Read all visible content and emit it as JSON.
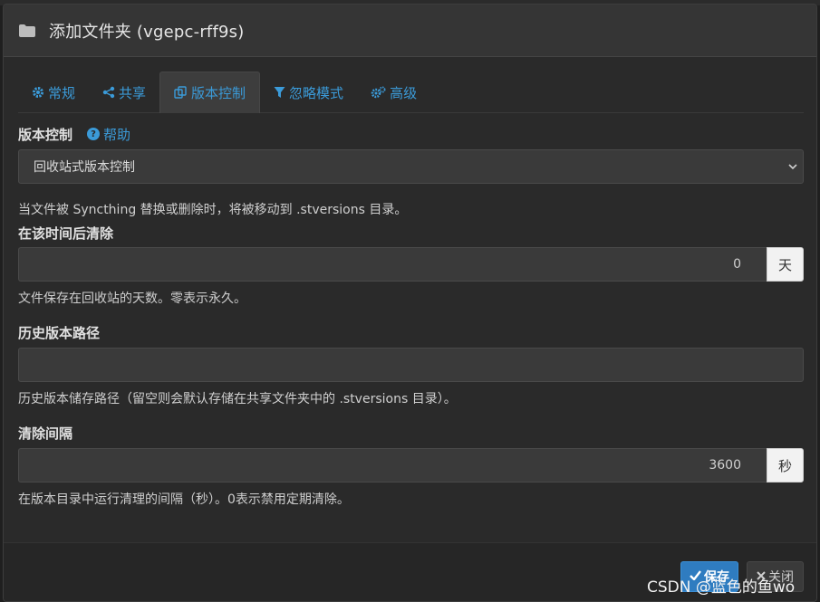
{
  "modal": {
    "title": "添加文件夹 (vgepc-rff9s)",
    "icon": "folder-icon"
  },
  "tabs": [
    {
      "label": "常规",
      "icon": "gear-icon",
      "active": false
    },
    {
      "label": "共享",
      "icon": "share-icon",
      "active": false
    },
    {
      "label": "版本控制",
      "icon": "copy-icon",
      "active": true
    },
    {
      "label": "忽略模式",
      "icon": "filter-icon",
      "active": false
    },
    {
      "label": "高级",
      "icon": "gears-icon",
      "active": false
    }
  ],
  "versioning": {
    "label": "版本控制",
    "help_label": "帮助",
    "selected": "回收站式版本控制",
    "description": "当文件被 Syncthing 替换或删除时，将被移动到 .stversions 目录。"
  },
  "cleanout": {
    "label": "在该时间后清除",
    "value": "0",
    "unit": "天",
    "help": "文件保存在回收站的天数。零表示永久。"
  },
  "path": {
    "label": "历史版本路径",
    "value": "",
    "help": "历史版本储存路径（留空则会默认存储在共享文件夹中的 .stversions 目录）。"
  },
  "interval": {
    "label": "清除间隔",
    "value": "3600",
    "unit": "秒",
    "help": "在版本目录中运行清理的间隔（秒）。0表示禁用定期清除。"
  },
  "footer": {
    "save_label": "保存",
    "close_label": "关闭"
  },
  "watermark": "CSDN @蓝色的鱼wo",
  "colors": {
    "accent": "#3b9bd9",
    "primary_button": "#2f7cc0",
    "background": "#2a2a2a"
  }
}
